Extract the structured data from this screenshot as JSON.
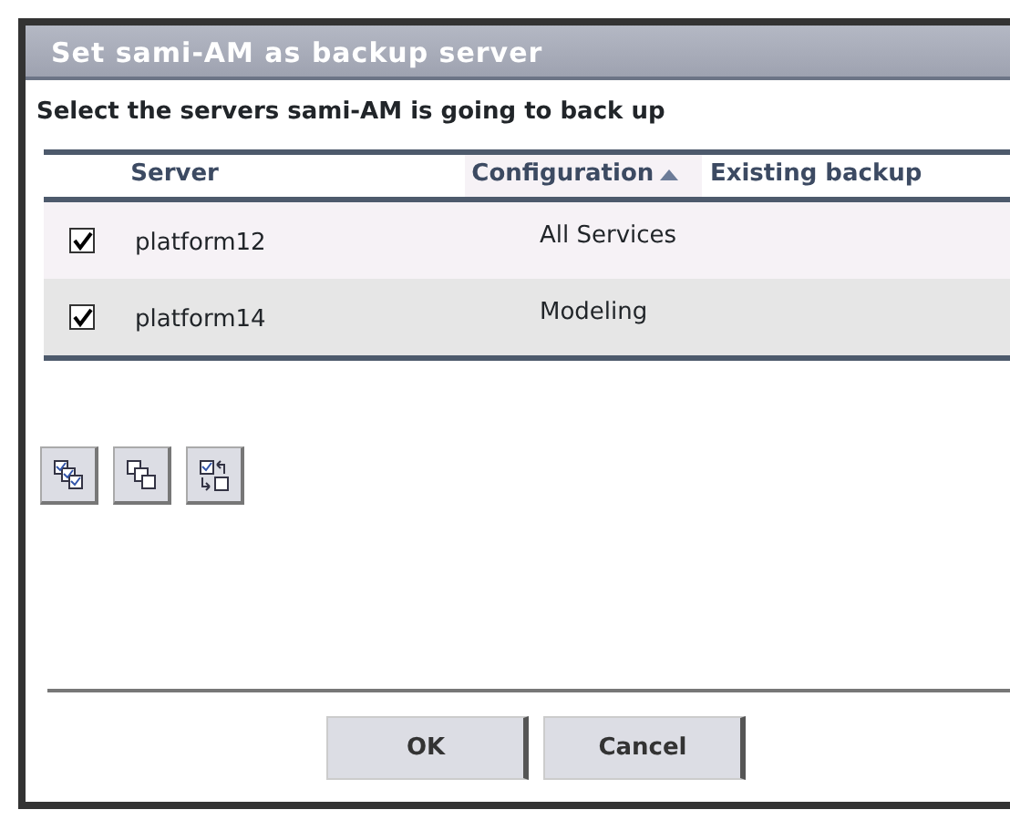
{
  "window": {
    "title": "Set sami-AM as backup server"
  },
  "instruction": "Select the servers sami-AM is going to back up",
  "table": {
    "columns": [
      {
        "label": "Server",
        "sorted": false
      },
      {
        "label": "Configuration",
        "sorted": true
      },
      {
        "label": "Existing backup",
        "sorted": false
      }
    ],
    "rows": [
      {
        "checked": true,
        "server": "platform12",
        "configuration": "All Services"
      },
      {
        "checked": true,
        "server": "platform14",
        "configuration": "Modeling"
      }
    ]
  },
  "tools": [
    {
      "kind": "select-all"
    },
    {
      "kind": "clear"
    },
    {
      "kind": "invert"
    }
  ],
  "buttons": [
    "OK",
    "Cancel"
  ]
}
